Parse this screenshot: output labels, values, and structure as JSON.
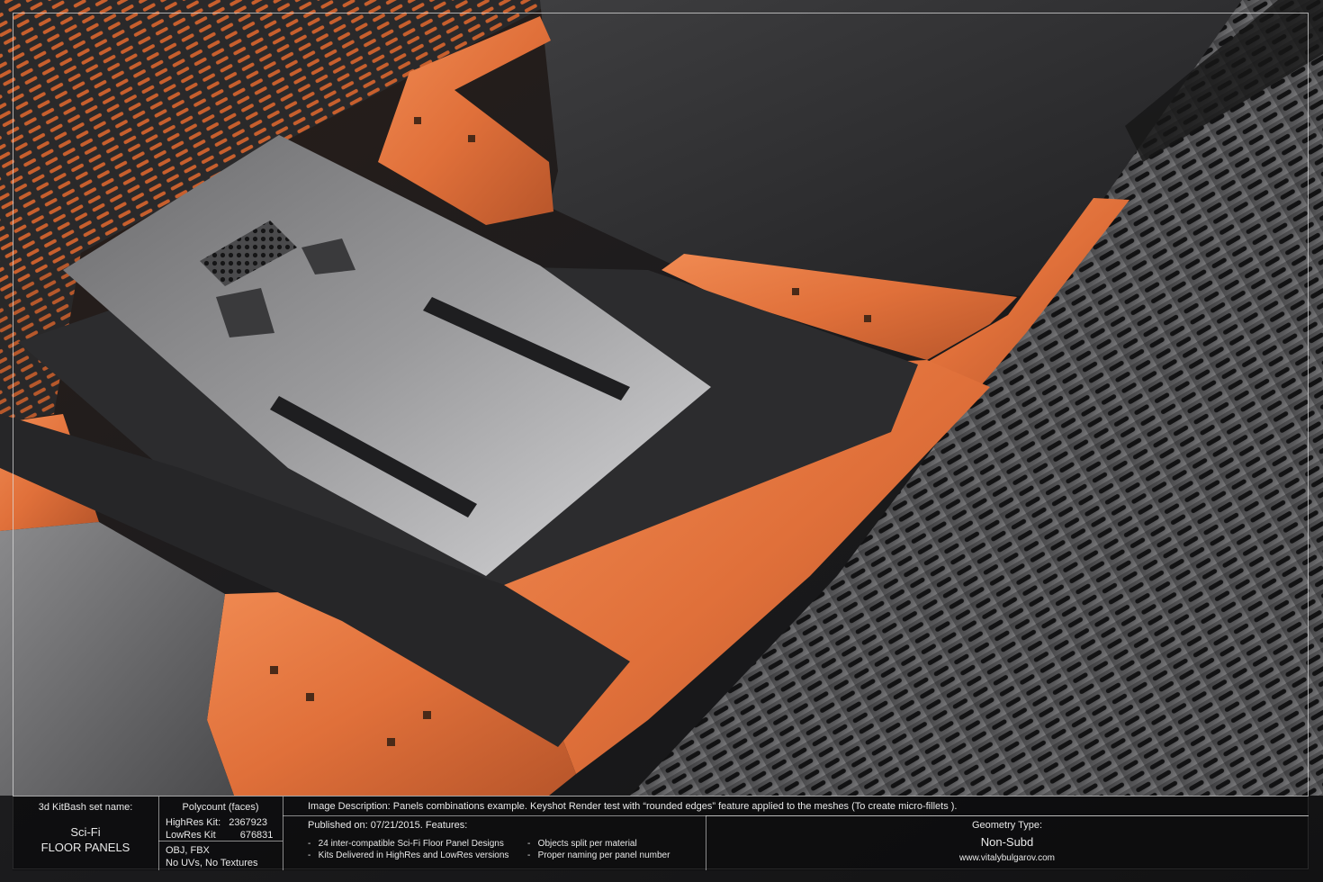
{
  "colors": {
    "accent_orange": "#e0703a",
    "panel_dark": "#2a2a2c",
    "grate_metal": "#3a3a3c",
    "info_bg": "#0c0c0d",
    "info_text": "#e8e8e8"
  },
  "info": {
    "set_name_label": "3d KitBash set name:",
    "set_name_line1": "Sci-Fi",
    "set_name_line2": "FLOOR PANELS",
    "polycount_label": "Polycount (faces)",
    "highres_label": "HighRes Kit:",
    "highres_value": "2367923",
    "lowres_label": "LowRes Kit",
    "lowres_value": "676831",
    "formats": "OBJ, FBX",
    "uv_note": "No UVs, No Textures",
    "description": "Image Description: Panels combinations example. Keyshot Render test with “rounded edges” feature applied to the meshes (To create micro-fillets ).",
    "published": "Published on: 07/21/2015. Features:",
    "features": [
      "24 inter-compatible Sci-Fi Floor Panel Designs",
      "Kits Delivered in HighRes and LowRes versions",
      "Objects split per material",
      "Proper naming per panel number"
    ],
    "geometry_label": "Geometry Type:",
    "geometry_value": "Non-Subd",
    "website": "www.vitalybulgarov.com"
  }
}
